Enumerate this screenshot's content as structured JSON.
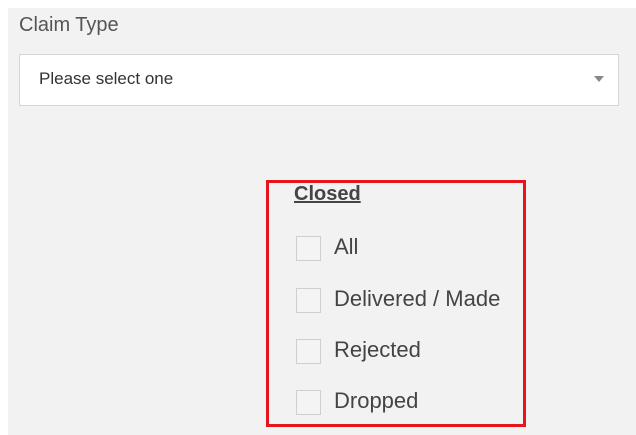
{
  "claim_type": {
    "label": "Claim Type",
    "selected_value": "Please select one",
    "caret_icon": "caret-down-icon"
  },
  "closed_filter": {
    "heading": "Closed",
    "options": [
      {
        "label": "All",
        "checked": false
      },
      {
        "label": "Delivered / Made",
        "checked": false
      },
      {
        "label": "Rejected",
        "checked": false
      },
      {
        "label": "Dropped",
        "checked": false
      }
    ]
  },
  "colors": {
    "highlight_border": "#e8141c",
    "panel_background": "#f2f2f2"
  }
}
